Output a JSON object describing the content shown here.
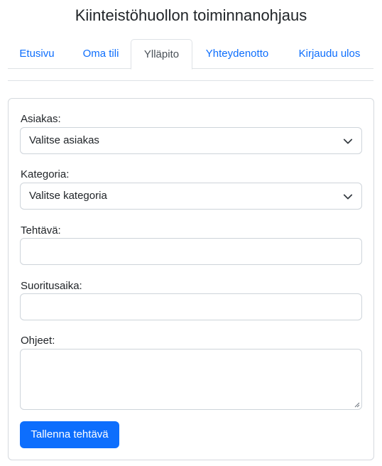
{
  "header": {
    "title": "Kiinteistöhuollon toiminnanohjaus"
  },
  "nav": {
    "tabs": [
      {
        "label": "Etusivu",
        "active": false
      },
      {
        "label": "Oma tili",
        "active": false
      },
      {
        "label": "Ylläpito",
        "active": true
      },
      {
        "label": "Yhteydenotto",
        "active": false
      },
      {
        "label": "Kirjaudu ulos",
        "active": false
      }
    ]
  },
  "form": {
    "customer": {
      "label": "Asiakas:",
      "value": "Valitse asiakas",
      "icon": "chevron-down-icon"
    },
    "category": {
      "label": "Kategoria:",
      "value": "Valitse kategoria",
      "icon": "chevron-down-icon"
    },
    "task": {
      "label": "Tehtävä:",
      "value": ""
    },
    "duration": {
      "label": "Suoritusaika:",
      "value": ""
    },
    "instructions": {
      "label": "Ohjeet:",
      "value": ""
    },
    "submit_label": "Tallenna tehtävä"
  },
  "colors": {
    "accent": "#0d6efd",
    "text": "#212529",
    "border": "#ced4da",
    "tab_border": "#dee2e6"
  }
}
